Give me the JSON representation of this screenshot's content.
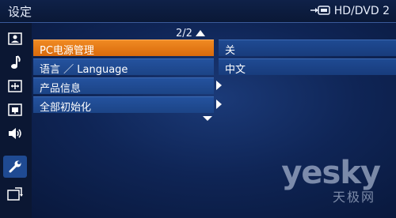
{
  "header": {
    "title": "设定",
    "device_icon": "hdmi-connector-icon",
    "device_label": "HD/DVD 2"
  },
  "sidebar": {
    "items": [
      {
        "icon": "picture-icon",
        "active": false
      },
      {
        "icon": "music-note-icon",
        "active": false
      },
      {
        "icon": "screen-adjust-icon",
        "active": false
      },
      {
        "icon": "display-settings-icon",
        "active": false
      },
      {
        "icon": "speaker-icon",
        "active": false
      },
      {
        "icon": "wrench-icon",
        "active": true
      },
      {
        "icon": "input-source-icon",
        "active": false
      }
    ]
  },
  "pager": {
    "text": "2/2"
  },
  "menu": {
    "items": [
      {
        "label": "PC电源管理",
        "value": "关",
        "selected": true
      },
      {
        "label": "语言 ／ Language",
        "value": "中文",
        "selected": false
      },
      {
        "label": "产品信息",
        "has_submenu": true
      },
      {
        "label": "全部初始化",
        "has_submenu": true
      }
    ]
  },
  "watermark": {
    "main": "yesky",
    "sub": "天极网"
  },
  "colors": {
    "selected": "#f08a22",
    "row": "#24529e",
    "background": "#0f2556"
  }
}
